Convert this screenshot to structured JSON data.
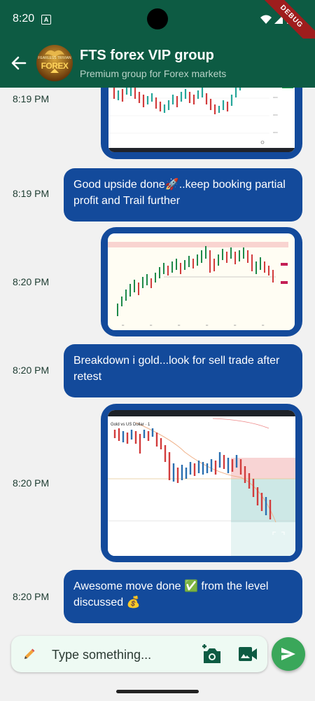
{
  "status_bar": {
    "time": "8:20",
    "debug_label": "DEBUG"
  },
  "header": {
    "title": "FTS forex VIP group",
    "subtitle": "Premium group for Forex markets",
    "avatar_text_top": "FEARLESS TRIVIAN",
    "avatar_text_main": "FOREX"
  },
  "messages": [
    {
      "type": "image",
      "time": "8:19 PM",
      "image": "candlestick-chart-uptrend"
    },
    {
      "type": "text",
      "time": "8:19 PM",
      "text": "Good upside done🚀..keep booking partial profit and Trail further"
    },
    {
      "type": "image",
      "time": "8:20 PM",
      "image": "candlestick-chart-range"
    },
    {
      "type": "text",
      "time": "8:20 PM",
      "text": "Breakdown i gold...look for sell trade after retest"
    },
    {
      "type": "image",
      "time": "8:20 PM",
      "image": "gold-vs-us-dollar-chart",
      "chart_caption": "Gold vs US Dollar · 1"
    },
    {
      "type": "text",
      "time": "8:20 PM",
      "text": "Awesome move done ✅ from the level discussed 💰"
    }
  ],
  "input": {
    "placeholder": "Type something..."
  },
  "colors": {
    "app_bar": "#0d5b43",
    "bubble": "#134a9b",
    "send": "#3aa75a"
  }
}
